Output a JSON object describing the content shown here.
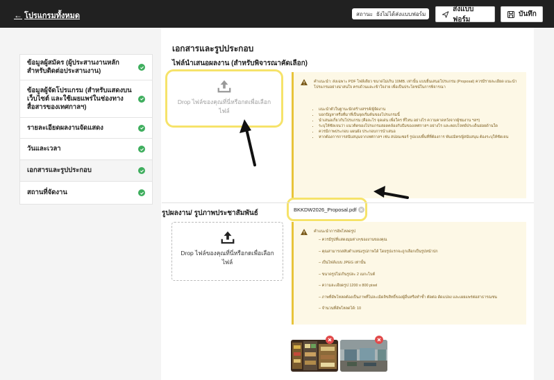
{
  "topbar": {
    "back_label": "โปรแกรมทั้งหมด",
    "status_label": "สถานะ",
    "status_value": "ยังไม่ได้ส่งแบบฟอร์ม",
    "send_label": "ส่งแบบฟอร์ม",
    "save_label": "บันทึก"
  },
  "sidebar": {
    "items": [
      {
        "label": "ข้อมูลผู้สมัคร (ผู้ประสานงานหลัก สำหรับติดต่อประสานงาน)"
      },
      {
        "label": "ข้อมูลผู้จัดโปรแกรม (สำหรับแสดงบนเว็บไซต์ และใช้เผยแพร่ในช่องทางสื่อสารของเทศกาลฯ)"
      },
      {
        "label": "รายละเอียดผลงานจัดแสดง"
      },
      {
        "label": "วันและเวลา"
      },
      {
        "label": "เอกสารและรูปประกอบ"
      },
      {
        "label": "สถานที่จัดงาน"
      }
    ]
  },
  "main": {
    "title": "เอกสารและรูปประกอบ",
    "proposal": {
      "heading": "ไฟล์นำเสนอผลงาน (สำหรับพิจารณาคัดเลือก)",
      "drop_text": "Drop ไฟล์ของคุณที่นี่หรือกดเพื่อเลือกไฟล์",
      "info_intro": "คำแนะนำ: ส่งเฉพาะ PDF ไฟล์เดียว ขนาดไม่เกิน 10MB. เท่านั้น แบบยื่นเสนอโปรแกรม (Proposal) ควรมีรายละเอียด แนะนำโปรแกรมอย่างน่าสนใจ ครบถ้วนและเข้าใจง่าย เพื่อเป็นประโยชน์ในการพิจารณา",
      "info_items": [
        "แนะนำตัวในฐานะนักสร้างสรรค์/ผู้จัดงาน",
        "บอกปัญหาหรือที่มาที่เป็นจุดเริ่มต้นของโปรแกรมนี้",
        "นำเสนอเกี่ยวกับโปรแกรม (คือละไร จุดเด่น เพื่อใคร ที่ไหน อย่างไร ความคาดหวังจากผู้ชมงาน ฯลฯ)",
        "ระบุให้ชัดเจนว่า แนวคิดของโปรแกรมสอดคล้องกับธีมของเทศกาลฯ อย่างไร และตอบโจทย์ประเด็นย่อยด้านใด",
        "ควรมีภาพประกอบ แผนผัง ประกอบการนำเสนอ",
        "หากต้องการการสนับสนุนจากเทศกาลฯ เช่น สปอนเซอร์ รูปแบบพื้นที่ที่ต้องการ พันธมิตร/ผู้สนับสนุน ต้องระบุให้ชัดเจน"
      ],
      "file_name": "BKKDW2026_Proposal.pdf"
    },
    "photos": {
      "heading": "รูปผลงาน/ รูปภาพประชาสัมพันธ์",
      "drop_text": "Drop ไฟล์ของคุณที่นี่หรือกดเพื่อเลือกไฟล์",
      "info_intro": "คำแนะนำการอัพโหลดรูป",
      "info_items": [
        "ควรมีรูปที่แสดงมุมต่างๆของงานของคุณ",
        "คุณสามารถสลับตำแหน่งรูปภาพได้ โดยรูปแรกจะถูกเลือกเป็นรูปหน้าปก",
        "เป็นไฟล์แบบ JPEG เท่านั้น",
        "ขนาดรูปไม่เกินรูปละ 2 เมกะไบต์",
        "ความละเอียดรูป 1200 x 800 pixel",
        "ภาพที่อัพโหลดต้องเป็นภาพที่ไม่ละเมิดลิขสิทธิ์ของผู้อื่นหรือทำซ้ำ ตัดต่อ ดัดแปลง และเผยแพร่ต่อสาธารณชน",
        "จำนวนที่อัพโหลดได้: 10"
      ]
    }
  },
  "colors": {
    "topbar": "#212121",
    "check": "#3fae5e",
    "highlight": "#f6e36a",
    "info_bg": "#fdf8e6",
    "delete": "#e14a4a"
  }
}
